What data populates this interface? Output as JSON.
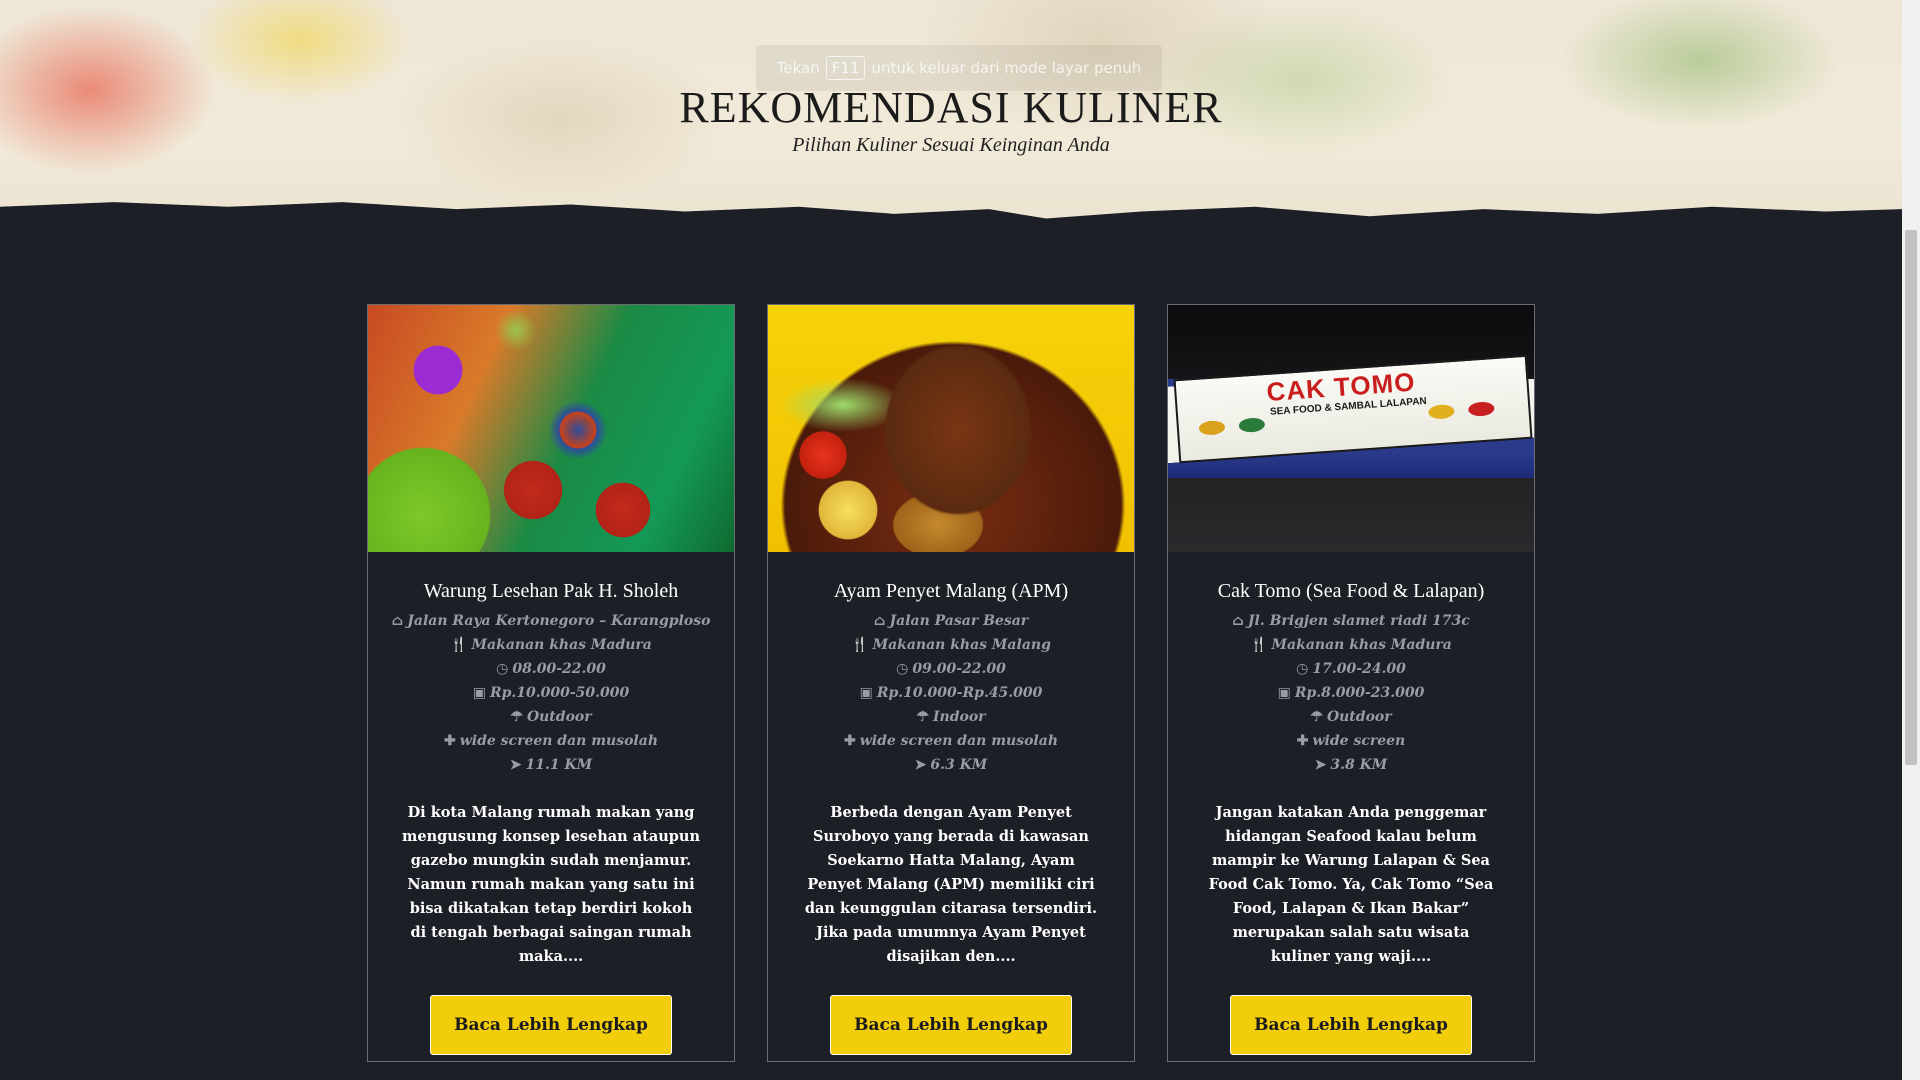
{
  "fullscreen_hint": {
    "prefix": "Tekan",
    "key": "F11",
    "suffix": "untuk keluar dari mode layar penuh"
  },
  "section": {
    "title": "REKOMENDASI KULINER",
    "subtitle": "Pilihan Kuliner Sesuai Keinginan Anda"
  },
  "cards": [
    {
      "title": "Warung Lesehan Pak H. Sholeh",
      "address": "Jalan Raya Kertonegoro – Karangploso",
      "cuisine": "Makanan khas Madura",
      "hours": "08.00-22.00",
      "price": "Rp.10.000-50.000",
      "seating": "Outdoor",
      "facilities": "wide screen dan musolah",
      "distance": "11.1 KM",
      "description": "Di kota Malang rumah makan yang mengusung konsep lesehan ataupun gazebo mungkin sudah menjamur. Namun rumah makan yang satu ini bisa dikatakan tetap berdiri kokoh di tengah berbagai saingan rumah maka....",
      "button": "Baca Lebih Lengkap"
    },
    {
      "title": "Ayam Penyet Malang (APM)",
      "address": "Jalan Pasar Besar",
      "cuisine": "Makanan khas Malang",
      "hours": "09.00-22.00",
      "price": "Rp.10.000-Rp.45.000",
      "seating": "Indoor",
      "facilities": "wide screen dan musolah",
      "distance": "6.3 KM",
      "description": "Berbeda dengan Ayam Penyet Suroboyo yang berada di kawasan Soekarno Hatta Malang, Ayam Penyet Malang (APM) memiliki ciri dan keunggulan citarasa tersendiri. Jika pada umumnya Ayam Penyet disajikan den....",
      "button": "Baca Lebih Lengkap"
    },
    {
      "title": "Cak Tomo (Sea Food & Lalapan)",
      "address": "Jl. Brigjen slamet riadi 173c",
      "cuisine": "Makanan khas Madura",
      "hours": "17.00-24.00",
      "price": "Rp.8.000-23.000",
      "seating": "Outdoor",
      "facilities": "wide screen",
      "distance": "3.8 KM",
      "description": "Jangan katakan Anda penggemar hidangan Seafood kalau belum mampir ke Warung Lalapan & Sea Food Cak Tomo. Ya, Cak Tomo “Sea Food, Lalapan & Ikan Bakar” merupakan salah satu wisata kuliner yang waji....",
      "button": "Baca Lebih Lengkap",
      "photo_sign": {
        "name": "CAK TOMO",
        "tagline": "SEA FOOD & SAMBAL LALAPAN"
      }
    }
  ],
  "icons": {
    "address": "home-icon",
    "cuisine": "cutlery-icon",
    "hours": "clock-icon",
    "price": "money-icon",
    "seating": "umbrella-icon",
    "facilities": "plus-icon",
    "distance": "location-arrow-icon"
  },
  "colors": {
    "background": "#1c1f26",
    "button": "#f2cd0a",
    "meta_text": "#9a9ca3",
    "card_border": "#6a6c72"
  }
}
